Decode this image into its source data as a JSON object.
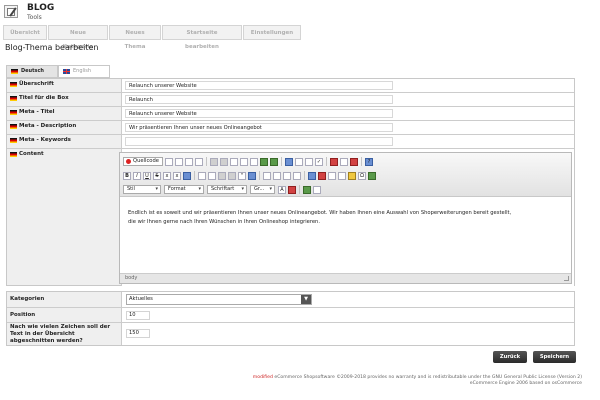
{
  "app": {
    "title": "BLOG",
    "subtitle": "Tools"
  },
  "nav": {
    "tabs": [
      "Übersicht",
      "Neue Kategorie",
      "Neues Thema",
      "Startseite bearbeiten",
      "Einstellungen"
    ]
  },
  "page_title": "Blog-Thema bearbeiten",
  "languages": {
    "active": "Deutsch",
    "inactive": "English"
  },
  "fields": {
    "ueberschrift": {
      "label": "Überschrift",
      "value": "Relaunch unserer Website"
    },
    "titel_box": {
      "label": "Titel für die Box",
      "value": "Relaunch"
    },
    "meta_titel": {
      "label": "Meta - Titel",
      "value": "Relaunch unserer Website"
    },
    "meta_description": {
      "label": "Meta - Description",
      "value": "Wir präsentieren Ihnen unser neues Onlineangebot"
    },
    "meta_keywords": {
      "label": "Meta - Keywords",
      "value": ""
    },
    "content": {
      "label": "Content"
    }
  },
  "editor": {
    "source_label": "Quellcode",
    "style_label": "Stil",
    "format_label": "Format",
    "font_label": "Schriftart",
    "size_label": "Gr...",
    "content_line1": "Endlich ist es soweit und wir präsentieren Ihnen unser neues Onlineangebot. Wir haben Ihnen eine Auswahl von Shoperweiterungen bereit gestellt,",
    "content_line2": "die wir Ihnen gerne nach Ihren Wünschen in Ihren Onlineshop integrieren.",
    "status_path": "body"
  },
  "meta": {
    "kategorien": {
      "label": "Kategorien",
      "value": "Aktuelles"
    },
    "position": {
      "label": "Position",
      "value": "10"
    },
    "zeichen": {
      "label": "Nach wie vielen Zeichen soll der Text in der Übersicht abgeschnitten werden?",
      "value": "150"
    }
  },
  "buttons": {
    "back": "Zurück",
    "save": "Speichern"
  },
  "footer": {
    "brand": "modified",
    "line1": " eCommerce Shopsoftware ©2009-2018 provides no warranty and is redistributable under the GNU General Public License (Version 2)",
    "line2": "eCommerce Engine 2006 based on osCommerce"
  },
  "colors": {
    "button": "#333333",
    "panel": "#efefef",
    "brand": "#cc2222"
  }
}
